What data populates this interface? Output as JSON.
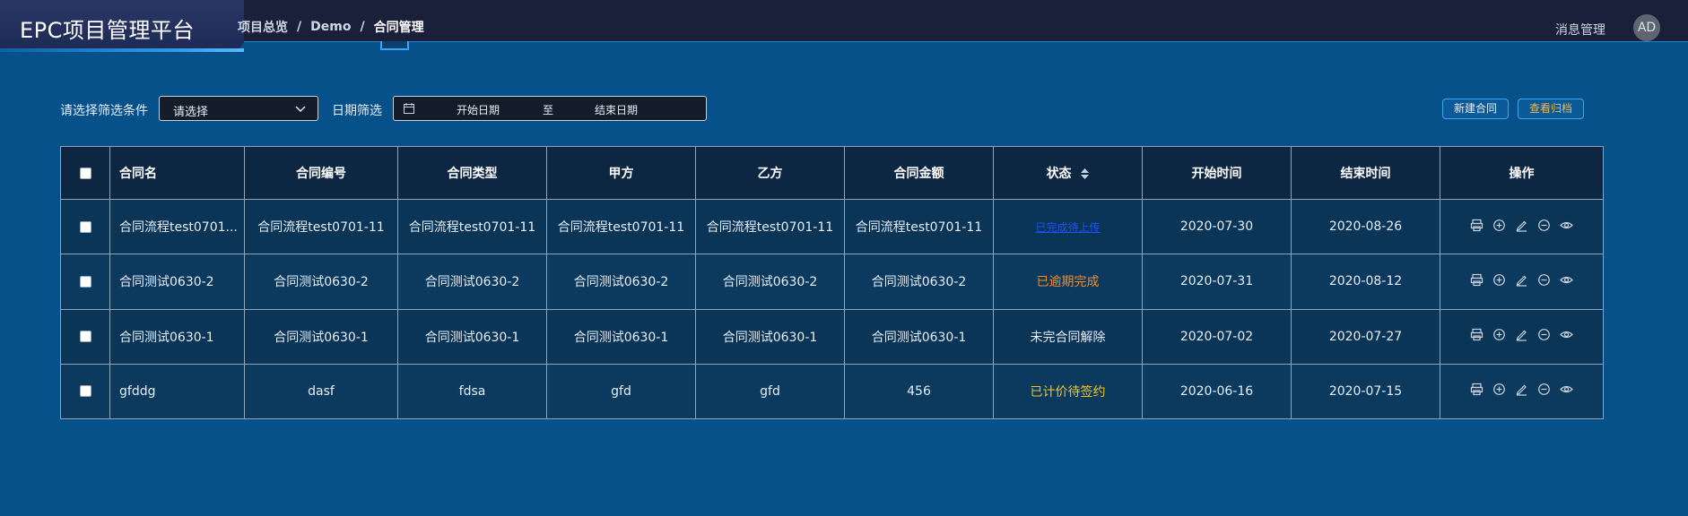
{
  "header": {
    "app_title": "EPC项目管理平台",
    "breadcrumb": [
      "项目总览",
      "Demo",
      "合同管理"
    ],
    "separator": "/",
    "message_link": "消息管理",
    "avatar_initials": "AD"
  },
  "filters": {
    "condition_label": "请选择筛选条件",
    "condition_value": "请选择",
    "date_label": "日期筛选",
    "date_start_placeholder": "开始日期",
    "date_to": "至",
    "date_end_placeholder": "结束日期"
  },
  "actions": {
    "new_contract": "新建合同",
    "view_archive": "查看归档"
  },
  "table": {
    "columns": [
      "合同名",
      "合同编号",
      "合同类型",
      "甲方",
      "乙方",
      "合同金额",
      "状态",
      "开始时间",
      "结束时间",
      "操作"
    ],
    "rows": [
      {
        "name": "合同流程test0701...",
        "code": "合同流程test0701-11",
        "type": "合同流程test0701-11",
        "party_a": "合同流程test0701-11",
        "party_b": "合同流程test0701-11",
        "amount": "合同流程test0701-11",
        "status": "已完成待上传",
        "start": "2020-07-30",
        "end": "2020-08-26"
      },
      {
        "name": "合同测试0630-2",
        "code": "合同测试0630-2",
        "type": "合同测试0630-2",
        "party_a": "合同测试0630-2",
        "party_b": "合同测试0630-2",
        "amount": "合同测试0630-2",
        "status": "已逾期完成",
        "start": "2020-07-31",
        "end": "2020-08-12"
      },
      {
        "name": "合同测试0630-1",
        "code": "合同测试0630-1",
        "type": "合同测试0630-1",
        "party_a": "合同测试0630-1",
        "party_b": "合同测试0630-1",
        "amount": "合同测试0630-1",
        "status": "未完合同解除",
        "start": "2020-07-02",
        "end": "2020-07-27"
      },
      {
        "name": "gfddg",
        "code": "dasf",
        "type": "fdsa",
        "party_a": "gfd",
        "party_b": "gfd",
        "amount": "456",
        "status": "已计价待签约",
        "start": "2020-06-16",
        "end": "2020-07-15"
      }
    ],
    "status_colors": {
      "link": "#1f4fff",
      "orange": "#f28c28",
      "white": "#e6eef7",
      "yellow": "#f5c518"
    },
    "row_action_icons": [
      "print-icon",
      "add-circle-icon",
      "edit-icon",
      "minus-circle-icon",
      "eye-icon"
    ]
  },
  "colors": {
    "page_bg": "#07518a",
    "topbar_bg": "#1a1f3a",
    "accent_blue": "#3aa8f0",
    "archive_btn_text": "#f0b64a"
  }
}
